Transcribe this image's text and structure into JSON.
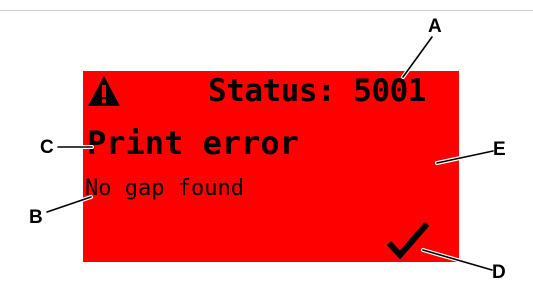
{
  "screen": {
    "status_text": "Status: 5001",
    "title": "Print error",
    "message": "No gap found",
    "background_color": "#ff0000",
    "icons": {
      "top_left": "warning-icon",
      "bottom_right": "checkmark-icon"
    }
  },
  "callouts": {
    "a": "A",
    "b": "B",
    "c": "C",
    "d": "D",
    "e": "E"
  }
}
